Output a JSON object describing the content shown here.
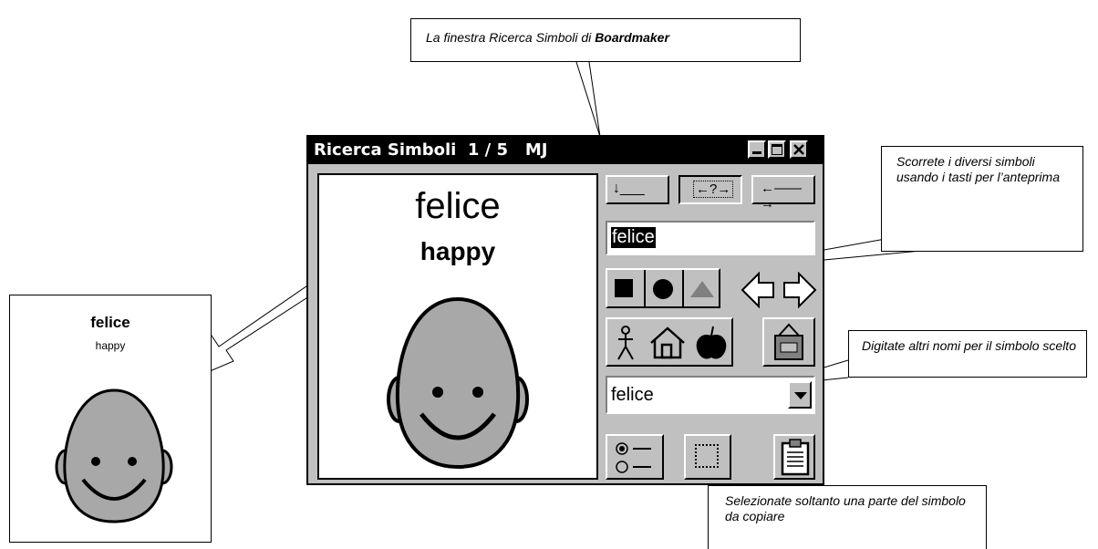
{
  "callouts": {
    "title_prefix": "La finestra Ricerca Simboli di ",
    "title_bold": "Boardmaker",
    "scroll": "Scorrete i diversi simboli usando i tasti per l’anteprima",
    "names": "Digitate altri nomi per il simbolo scelto",
    "select": "Selezionate soltanto una parte del simbolo da copiare"
  },
  "card": {
    "word": "felice",
    "translation": "happy"
  },
  "window": {
    "title": "Ricerca Simboli  1 / 5   MJ",
    "search_value": "felice",
    "name_select_value": "felice",
    "preview_word": "felice",
    "preview_translation": "happy",
    "preview_buttons": [
      "↓___",
      "←?→",
      "←——→"
    ]
  }
}
